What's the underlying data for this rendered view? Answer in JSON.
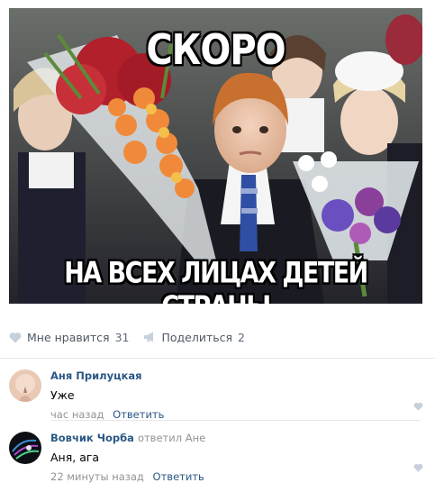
{
  "post": {
    "meme_top_text": "СКОРО",
    "meme_bottom_text": "НА ВСЕХ ЛИЦАХ ДЕТЕЙ СТРАНЫ"
  },
  "actions": {
    "like_label": "Мне нравится",
    "like_count": "31",
    "share_label": "Поделиться",
    "share_count": "2"
  },
  "comments": [
    {
      "author": "Аня Прилуцкая",
      "replied_to": "",
      "text": "Уже",
      "time": "час назад",
      "reply_label": "Ответить"
    },
    {
      "author": "Вовчик Чорба",
      "replied_to": "ответил Ане",
      "text": "Аня, ага",
      "time": "22 минуты назад",
      "reply_label": "Ответить"
    }
  ],
  "colors": {
    "link": "#2a5885",
    "muted": "#939393",
    "icon": "#c6d0dc"
  }
}
